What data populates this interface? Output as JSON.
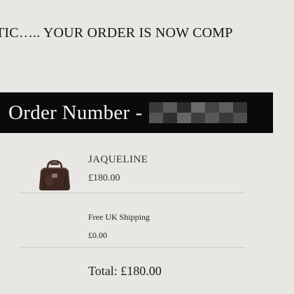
{
  "header": {
    "headline": "TIC….. YOUR ORDER IS NOW COMP"
  },
  "order": {
    "label": "Order Number",
    "separator": "-",
    "number_redacted": "••••••"
  },
  "items": [
    {
      "name": "JAQUELINE",
      "price": "£180.00",
      "icon": "handbag-thumbnail"
    }
  ],
  "shipping": {
    "label": "Free UK Shipping",
    "price": "£0.00"
  },
  "summary": {
    "total": "Total: £180.00"
  },
  "colors": {
    "page_bg": "#e8e7e3",
    "order_bar_bg": "#0a0a0a",
    "order_bar_text": "#f4f4f2",
    "divider": "#cfcdc8"
  }
}
